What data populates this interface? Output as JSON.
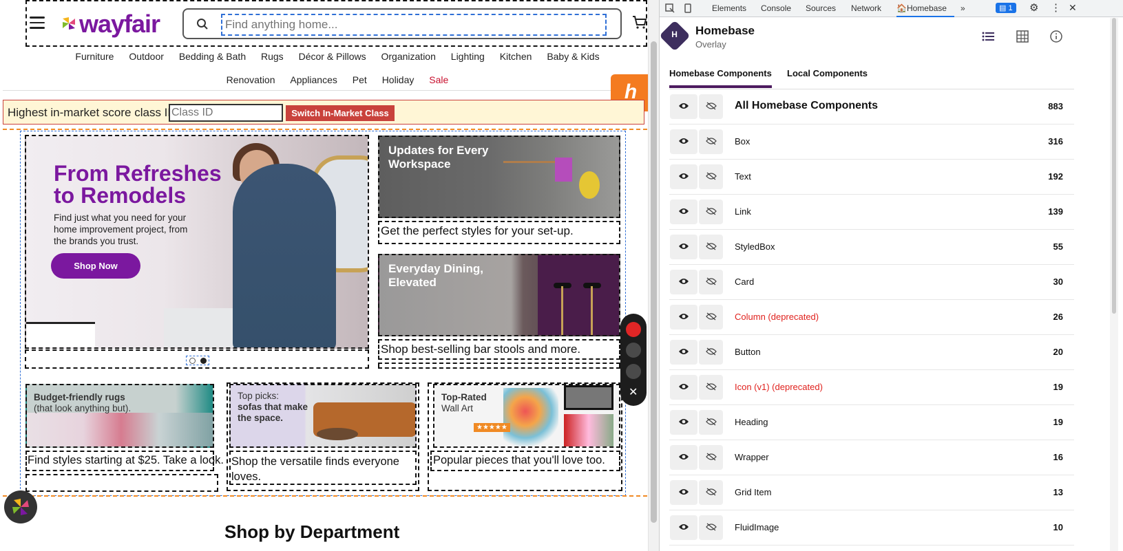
{
  "site": {
    "logo": "wayfair",
    "search_placeholder": "Find anything home...",
    "nav_row1": [
      "Furniture",
      "Outdoor",
      "Bedding & Bath",
      "Rugs",
      "Décor & Pillows",
      "Organization",
      "Lighting",
      "Kitchen",
      "Baby & Kids"
    ],
    "nav_row2": [
      "Renovation",
      "Appliances",
      "Pet",
      "Holiday",
      "Sale"
    ],
    "market_label": "Highest in-market score class ID:",
    "class_placeholder": "Class ID",
    "switch_button": "Switch In-Market Class",
    "hero": {
      "title": "From Refreshes to Remodels",
      "body": "Find just what you need for your home improvement project, from the brands you trust.",
      "cta": "Shop Now"
    },
    "card1": {
      "title": "Updates for Every Workspace",
      "caption": "Get the perfect styles for your set-up."
    },
    "card2": {
      "title": "Everyday Dining, Elevated",
      "caption": "Shop best-selling bar stools and more."
    },
    "bottom": [
      {
        "title_line1": "Budget-friendly rugs",
        "title_line2": "(that look anything but).",
        "caption": "Find styles starting at $25. Take a look."
      },
      {
        "title_line1": "Top picks:",
        "title_line2": "sofas that make the space.",
        "caption": "Shop the versatile finds everyone loves."
      },
      {
        "title_line1": "Top-Rated",
        "title_line2": "Wall Art",
        "caption": "Popular pieces that you'll love too."
      }
    ],
    "section_peek": "Shop by Department",
    "colors": {
      "brand": "#7b189f",
      "accent": "#f47b20",
      "alert": "#c9423c"
    }
  },
  "devtools": {
    "tabs": [
      "Elements",
      "Console",
      "Sources",
      "Network",
      "Homebase"
    ],
    "issues_count": "1",
    "panel_title": "Homebase",
    "panel_subtitle": "Overlay",
    "subtabs": [
      "Homebase Components",
      "Local Components"
    ],
    "rows": [
      {
        "name": "All Homebase Components",
        "count": "883"
      },
      {
        "name": "Box",
        "count": "316"
      },
      {
        "name": "Text",
        "count": "192"
      },
      {
        "name": "Link",
        "count": "139"
      },
      {
        "name": "StyledBox",
        "count": "55"
      },
      {
        "name": "Card",
        "count": "30"
      },
      {
        "name": "Column (deprecated)",
        "count": "26"
      },
      {
        "name": "Button",
        "count": "20"
      },
      {
        "name": "Icon (v1) (deprecated)",
        "count": "19"
      },
      {
        "name": "Heading",
        "count": "19"
      },
      {
        "name": "Wrapper",
        "count": "16"
      },
      {
        "name": "Grid Item",
        "count": "13"
      },
      {
        "name": "FluidImage",
        "count": "10"
      }
    ]
  }
}
